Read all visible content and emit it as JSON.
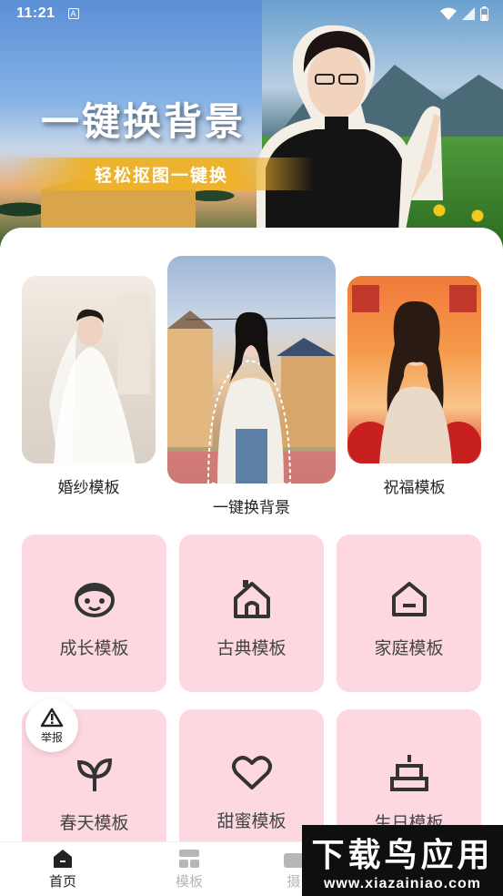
{
  "status_bar": {
    "time": "11:21",
    "notification": "A"
  },
  "hero": {
    "title": "一键换背景",
    "subtitle": "轻松抠图一键换"
  },
  "featured": [
    {
      "label": "婚纱模板"
    },
    {
      "label": "一键换背景"
    },
    {
      "label": "祝福模板"
    }
  ],
  "templates": [
    {
      "label": "成长模板",
      "icon": "baby-face-icon"
    },
    {
      "label": "古典模板",
      "icon": "classic-house-icon"
    },
    {
      "label": "家庭模板",
      "icon": "home-icon"
    },
    {
      "label": "春天模板",
      "icon": "leaf-icon"
    },
    {
      "label": "甜蜜模板",
      "icon": "heart-icon"
    },
    {
      "label": "生日模板",
      "icon": "cake-icon"
    }
  ],
  "report_button": {
    "label": "举报"
  },
  "bottom_nav": [
    {
      "label": "首页",
      "icon": "home-nav-icon",
      "active": true
    },
    {
      "label": "模板",
      "icon": "template-nav-icon",
      "active": false
    },
    {
      "label": "摄",
      "icon": "camera-nav-icon",
      "active": false
    }
  ],
  "watermark": {
    "title": "下载鸟应用",
    "url": "www.xiazainiao.com"
  },
  "colors": {
    "tile_bg": "#fdd8e0",
    "icon": "#333333",
    "nav_active": "#222222",
    "nav_inactive": "#b7b7b7"
  }
}
